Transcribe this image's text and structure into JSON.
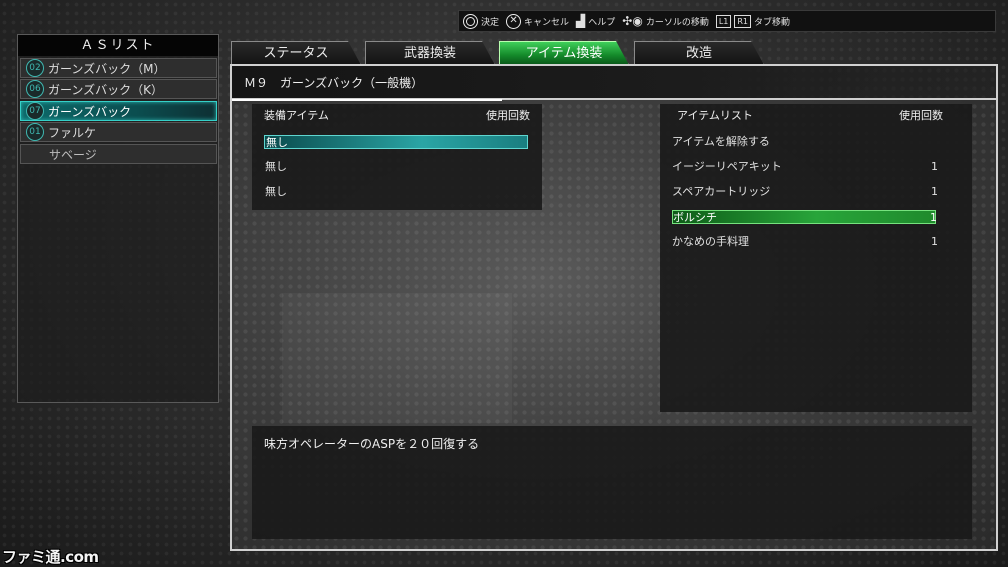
{
  "controls": [
    {
      "icon": "circle-button-icon",
      "label": "決定"
    },
    {
      "icon": "cross-button-icon",
      "label": "キャンセル"
    },
    {
      "icon": "touchpad-icon",
      "label": "ヘルプ"
    },
    {
      "icon": "dpad-stick-icon",
      "label": "カーソルの移動"
    },
    {
      "keys": [
        "L1",
        "R1"
      ],
      "label": "タブ移動"
    }
  ],
  "as_list": {
    "title": "ＡＳリスト",
    "items": [
      {
        "num": "02",
        "label": "ガーンズバック（M）",
        "selected": false
      },
      {
        "num": "06",
        "label": "ガーンズバック（K）",
        "selected": false
      },
      {
        "num": "07",
        "label": "ガーンズバック",
        "selected": true
      },
      {
        "num": "01",
        "label": "ファルケ",
        "selected": false
      },
      {
        "num": "",
        "label": "サベージ",
        "selected": false
      }
    ]
  },
  "tabs": [
    {
      "label": "ステータス",
      "active": false
    },
    {
      "label": "武器換装",
      "active": false
    },
    {
      "label": "アイテム換装",
      "active": true
    },
    {
      "label": "改造",
      "active": false
    }
  ],
  "unit_name": "Ｍ９　ガーンズバック（一般機）",
  "equip": {
    "header_left": "装備アイテム",
    "header_right": "使用回数",
    "rows": [
      "無し",
      "無し",
      "無し"
    ],
    "selected_index": 0
  },
  "item_list": {
    "header_left": "アイテムリスト",
    "header_right": "使用回数",
    "rows": [
      {
        "name": "アイテムを解除する",
        "count": ""
      },
      {
        "name": "イージーリペアキット",
        "count": "1"
      },
      {
        "name": "スペアカートリッジ",
        "count": "1"
      },
      {
        "name": "ボルシチ",
        "count": "1"
      },
      {
        "name": "かなめの手料理",
        "count": "1"
      }
    ],
    "selected_index": 3
  },
  "description": "味方オペレーターのASPを２０回復する",
  "watermark": "ファミ通.com",
  "colors": {
    "active_tab": "#2fb84a",
    "selection_teal": "#2aa5a5",
    "selection_green": "#28a53a",
    "number_badge": "#3fb7b0"
  }
}
